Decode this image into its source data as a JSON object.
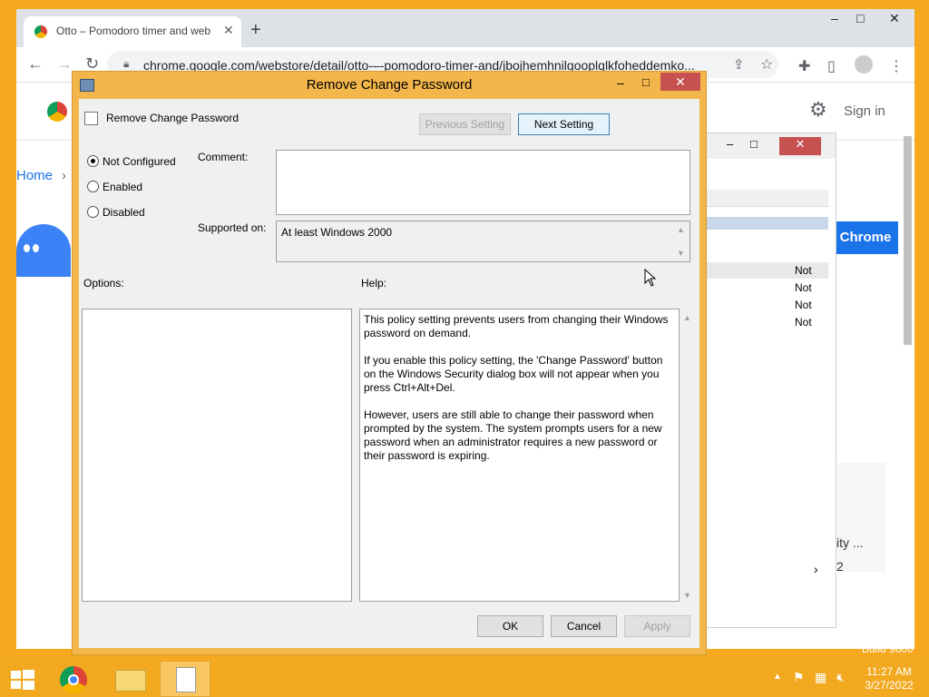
{
  "browser": {
    "tab_title": "Otto – Pomodoro timer and web",
    "tab_close": "✕",
    "new_tab": "+",
    "window_controls": [
      "–",
      "□",
      "✕"
    ],
    "url": "chrome.google.com/webstore/detail/otto-–-pomodoro-timer-and/jbojhemhnilgooplqlkfoheddemko...",
    "store": {
      "sign_in": "Sign in",
      "breadcrumb_home": "Home",
      "breadcrumb_sep": "›",
      "add_button": "Chrome",
      "frag_ity": "ity ...",
      "frag_2": "2",
      "watermark": "Build 9600"
    }
  },
  "bg_window": {
    "rows": [
      "Not",
      "Not",
      "Not",
      "Not"
    ],
    "controls": [
      "–",
      "□",
      "✕"
    ],
    "scroll_right": "›"
  },
  "dialog": {
    "title": "Remove Change Password",
    "controls": {
      "minimize": "–",
      "maximize": "□",
      "close": "✕"
    },
    "setting_name": "Remove Change Password",
    "prev_button": "Previous Setting",
    "next_button": "Next Setting",
    "options": [
      {
        "label": "Not Configured",
        "selected": true
      },
      {
        "label": "Enabled",
        "selected": false
      },
      {
        "label": "Disabled",
        "selected": false
      }
    ],
    "comment_label": "Comment:",
    "comment_value": "",
    "supported_label": "Supported on:",
    "supported_value": "At least Windows 2000",
    "options_label": "Options:",
    "help_label": "Help:",
    "help": [
      "This policy setting prevents users from changing their Windows password on demand.",
      "If you enable this policy setting,  the 'Change Password' button on the Windows Security dialog box will not appear when you press Ctrl+Alt+Del.",
      "However, users are still able to change their password when prompted by the system. The system prompts users for a new password when an administrator requires a new password or their password is expiring."
    ],
    "ok": "OK",
    "cancel": "Cancel",
    "apply": "Apply"
  },
  "taskbar": {
    "apps": [
      "start-button",
      "chrome-app",
      "file-explorer-app",
      "notepad-app"
    ],
    "time": "11:27 AM",
    "date": "3/27/2022"
  },
  "colors": {
    "desktop": "#f4a91e",
    "dialog_frame": "#f3b64b",
    "close_red": "#c75050",
    "link_blue": "#1a73e8"
  }
}
